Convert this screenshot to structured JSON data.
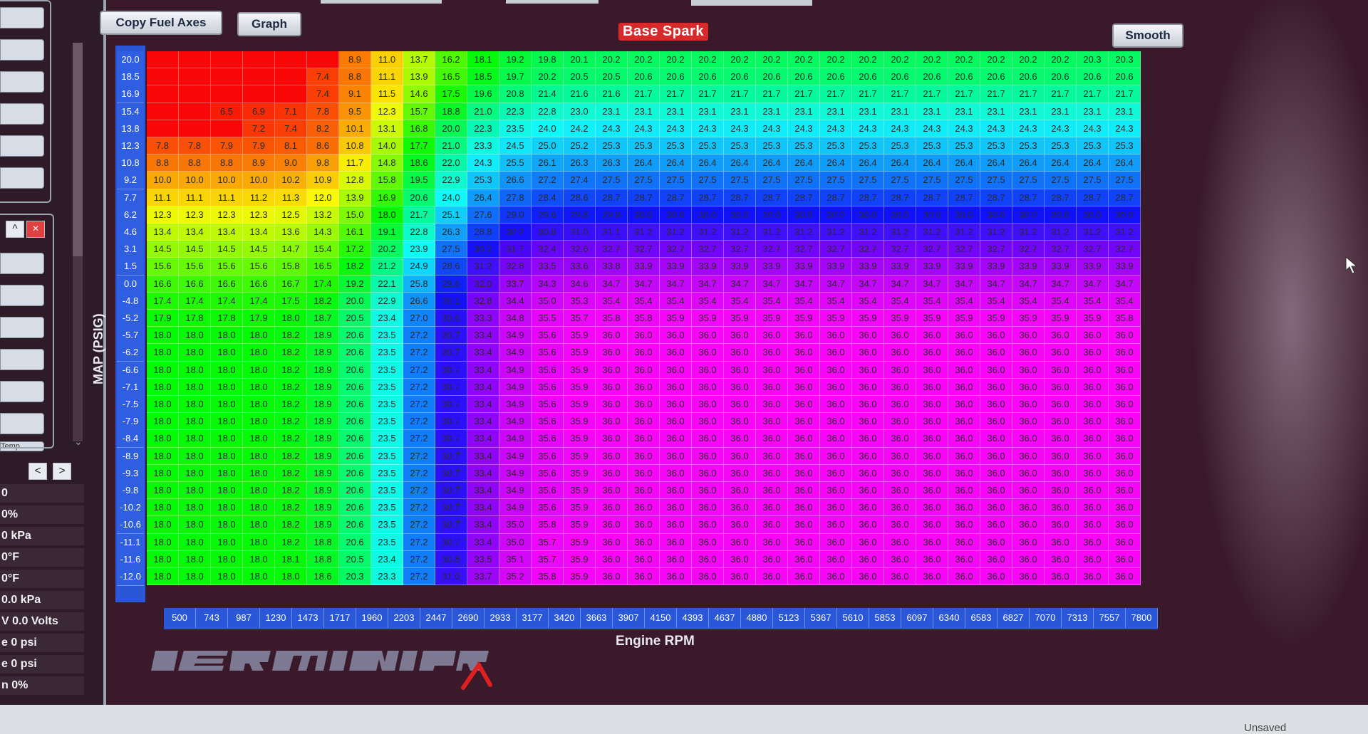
{
  "toolbar": {
    "copy_fuel_axes_label": "Copy Fuel Axes",
    "graph_label": "Graph",
    "smooth_label": "Smooth"
  },
  "table": {
    "title": "Base Spark",
    "x_axis_label": "Engine RPM",
    "y_axis_label": "MAP (PSIG)",
    "rpm": [
      500,
      743,
      987,
      1230,
      1473,
      1717,
      1960,
      2203,
      2447,
      2690,
      2933,
      3177,
      3420,
      3663,
      3907,
      4150,
      4393,
      4637,
      4880,
      5123,
      5367,
      5610,
      5853,
      6097,
      6340,
      6583,
      6827,
      7070,
      7313,
      7557,
      7800
    ],
    "map": [
      "20.0",
      "18.5",
      "16.9",
      "15.4",
      "13.8",
      "12.3",
      "10.8",
      "9.2",
      "7.7",
      "6.2",
      "4.6",
      "3.1",
      "1.5",
      "0.0",
      "-4.8",
      "-5.2",
      "-5.7",
      "-6.2",
      "-6.6",
      "-7.1",
      "-7.5",
      "-7.9",
      "-8.4",
      "-8.9",
      "-9.3",
      "-9.8",
      "-10.2",
      "-10.6",
      "-11.1",
      "-11.6",
      "-12.0"
    ],
    "rows": [
      [
        "",
        "",
        "",
        "",
        "",
        "",
        "8.9",
        "11.0",
        "13.7",
        "16.2",
        "18.1",
        "19.2",
        "19.8",
        "20.1",
        "20.2",
        "20.2",
        "20.2",
        "20.2",
        "20.2",
        "20.2",
        "20.2",
        "20.2",
        "20.2",
        "20.2",
        "20.2",
        "20.2",
        "20.2",
        "20.2",
        "20.2",
        "20.3",
        "20.3"
      ],
      [
        "",
        "",
        "",
        "",
        "",
        "7.4",
        "8.8",
        "11.1",
        "13.9",
        "16.5",
        "18.5",
        "19.7",
        "20.2",
        "20.5",
        "20.5",
        "20.6",
        "20.6",
        "20.6",
        "20.6",
        "20.6",
        "20.6",
        "20.6",
        "20.6",
        "20.6",
        "20.6",
        "20.6",
        "20.6",
        "20.6",
        "20.6",
        "20.6",
        "20.6"
      ],
      [
        "",
        "",
        "",
        "",
        "",
        "7.4",
        "9.1",
        "11.5",
        "14.6",
        "17.5",
        "19.6",
        "20.8",
        "21.4",
        "21.6",
        "21.6",
        "21.7",
        "21.7",
        "21.7",
        "21.7",
        "21.7",
        "21.7",
        "21.7",
        "21.7",
        "21.7",
        "21.7",
        "21.7",
        "21.7",
        "21.7",
        "21.7",
        "21.7",
        "21.7"
      ],
      [
        "",
        "",
        "6.5",
        "6.9",
        "7.1",
        "7.8",
        "9.5",
        "12.3",
        "15.7",
        "18.8",
        "21.0",
        "22.3",
        "22.8",
        "23.0",
        "23.1",
        "23.1",
        "23.1",
        "23.1",
        "23.1",
        "23.1",
        "23.1",
        "23.1",
        "23.1",
        "23.1",
        "23.1",
        "23.1",
        "23.1",
        "23.1",
        "23.1",
        "23.1",
        "23.1"
      ],
      [
        "",
        "",
        "",
        "7.2",
        "7.4",
        "8.2",
        "10.1",
        "13.1",
        "16.8",
        "20.0",
        "22.3",
        "23.5",
        "24.0",
        "24.2",
        "24.3",
        "24.3",
        "24.3",
        "24.3",
        "24.3",
        "24.3",
        "24.3",
        "24.3",
        "24.3",
        "24.3",
        "24.3",
        "24.3",
        "24.3",
        "24.3",
        "24.3",
        "24.3",
        "24.3"
      ],
      [
        "7.8",
        "7.8",
        "7.9",
        "7.9",
        "8.1",
        "8.6",
        "10.8",
        "14.0",
        "17.7",
        "21.0",
        "23.3",
        "24.5",
        "25.0",
        "25.2",
        "25.3",
        "25.3",
        "25.3",
        "25.3",
        "25.3",
        "25.3",
        "25.3",
        "25.3",
        "25.3",
        "25.3",
        "25.3",
        "25.3",
        "25.3",
        "25.3",
        "25.3",
        "25.3",
        "25.3"
      ],
      [
        "8.8",
        "8.8",
        "8.8",
        "8.9",
        "9.0",
        "9.8",
        "11.7",
        "14.8",
        "18.6",
        "22.0",
        "24.3",
        "25.5",
        "26.1",
        "26.3",
        "26.3",
        "26.4",
        "26.4",
        "26.4",
        "26.4",
        "26.4",
        "26.4",
        "26.4",
        "26.4",
        "26.4",
        "26.4",
        "26.4",
        "26.4",
        "26.4",
        "26.4",
        "26.4",
        "26.4"
      ],
      [
        "10.0",
        "10.0",
        "10.0",
        "10.0",
        "10.2",
        "10.9",
        "12.8",
        "15.8",
        "19.5",
        "22.9",
        "25.3",
        "26.6",
        "27.2",
        "27.4",
        "27.5",
        "27.5",
        "27.5",
        "27.5",
        "27.5",
        "27.5",
        "27.5",
        "27.5",
        "27.5",
        "27.5",
        "27.5",
        "27.5",
        "27.5",
        "27.5",
        "27.5",
        "27.5",
        "27.5"
      ],
      [
        "11.1",
        "11.1",
        "11.1",
        "11.2",
        "11.3",
        "12.0",
        "13.9",
        "16.9",
        "20.6",
        "24.0",
        "26.4",
        "27.8",
        "28.4",
        "28.6",
        "28.7",
        "28.7",
        "28.7",
        "28.7",
        "28.7",
        "28.7",
        "28.7",
        "28.7",
        "28.7",
        "28.7",
        "28.7",
        "28.7",
        "28.7",
        "28.7",
        "28.7",
        "28.7",
        "28.7"
      ],
      [
        "12.3",
        "12.3",
        "12.3",
        "12.3",
        "12.5",
        "13.2",
        "15.0",
        "18.0",
        "21.7",
        "25.1",
        "27.6",
        "29.0",
        "29.6",
        "29.8",
        "29.9",
        "30.0",
        "30.0",
        "30.0",
        "30.0",
        "30.0",
        "30.0",
        "30.0",
        "30.0",
        "30.0",
        "30.0",
        "30.0",
        "30.0",
        "30.0",
        "30.0",
        "30.0",
        "30.0"
      ],
      [
        "13.4",
        "13.4",
        "13.4",
        "13.4",
        "13.6",
        "14.3",
        "16.1",
        "19.1",
        "22.8",
        "26.3",
        "28.8",
        "30.2",
        "30.8",
        "31.0",
        "31.1",
        "31.2",
        "31.2",
        "31.2",
        "31.2",
        "31.2",
        "31.2",
        "31.2",
        "31.2",
        "31.2",
        "31.2",
        "31.2",
        "31.2",
        "31.2",
        "31.2",
        "31.2",
        "31.2"
      ],
      [
        "14.5",
        "14.5",
        "14.5",
        "14.5",
        "14.7",
        "15.4",
        "17.2",
        "20.2",
        "23.9",
        "27.5",
        "30.2",
        "31.7",
        "32.4",
        "32.6",
        "32.7",
        "32.7",
        "32.7",
        "32.7",
        "32.7",
        "32.7",
        "32.7",
        "32.7",
        "32.7",
        "32.7",
        "32.7",
        "32.7",
        "32.7",
        "32.7",
        "32.7",
        "32.7",
        "32.7"
      ],
      [
        "15.6",
        "15.6",
        "15.6",
        "15.6",
        "15.8",
        "16.5",
        "18.2",
        "21.2",
        "24.9",
        "28.6",
        "31.2",
        "32.8",
        "33.5",
        "33.6",
        "33.8",
        "33.9",
        "33.9",
        "33.9",
        "33.9",
        "33.9",
        "33.9",
        "33.9",
        "33.9",
        "33.9",
        "33.9",
        "33.9",
        "33.9",
        "33.9",
        "33.9",
        "33.9",
        "33.9"
      ],
      [
        "16.6",
        "16.6",
        "16.6",
        "16.6",
        "16.7",
        "17.4",
        "19.2",
        "22.1",
        "25.8",
        "29.6",
        "32.0",
        "33.7",
        "34.3",
        "34.6",
        "34.7",
        "34.7",
        "34.7",
        "34.7",
        "34.7",
        "34.7",
        "34.7",
        "34.7",
        "34.7",
        "34.7",
        "34.7",
        "34.7",
        "34.7",
        "34.7",
        "34.7",
        "34.7",
        "34.7"
      ],
      [
        "17.4",
        "17.4",
        "17.4",
        "17.4",
        "17.5",
        "18.2",
        "20.0",
        "22.9",
        "26.6",
        "30.1",
        "32.8",
        "34.4",
        "35.0",
        "35.3",
        "35.4",
        "35.4",
        "35.4",
        "35.4",
        "35.4",
        "35.4",
        "35.4",
        "35.4",
        "35.4",
        "35.4",
        "35.4",
        "35.4",
        "35.4",
        "35.4",
        "35.4",
        "35.4",
        "35.4"
      ],
      [
        "17.9",
        "17.8",
        "17.8",
        "17.9",
        "18.0",
        "18.7",
        "20.5",
        "23.4",
        "27.0",
        "30.6",
        "33.3",
        "34.8",
        "35.5",
        "35.7",
        "35.8",
        "35.8",
        "35.9",
        "35.9",
        "35.9",
        "35.9",
        "35.9",
        "35.9",
        "35.9",
        "35.9",
        "35.9",
        "35.9",
        "35.9",
        "35.9",
        "35.9",
        "35.9",
        "35.8"
      ],
      [
        "18.0",
        "18.0",
        "18.0",
        "18.0",
        "18.2",
        "18.9",
        "20.6",
        "23.5",
        "27.2",
        "30.7",
        "33.4",
        "34.9",
        "35.6",
        "35.9",
        "36.0",
        "36.0",
        "36.0",
        "36.0",
        "36.0",
        "36.0",
        "36.0",
        "36.0",
        "36.0",
        "36.0",
        "36.0",
        "36.0",
        "36.0",
        "36.0",
        "36.0",
        "36.0",
        "36.0"
      ],
      [
        "18.0",
        "18.0",
        "18.0",
        "18.0",
        "18.2",
        "18.9",
        "20.6",
        "23.5",
        "27.2",
        "30.7",
        "33.4",
        "34.9",
        "35.6",
        "35.9",
        "36.0",
        "36.0",
        "36.0",
        "36.0",
        "36.0",
        "36.0",
        "36.0",
        "36.0",
        "36.0",
        "36.0",
        "36.0",
        "36.0",
        "36.0",
        "36.0",
        "36.0",
        "36.0",
        "36.0"
      ],
      [
        "18.0",
        "18.0",
        "18.0",
        "18.0",
        "18.2",
        "18.9",
        "20.6",
        "23.5",
        "27.2",
        "30.7",
        "33.4",
        "34.9",
        "35.6",
        "35.9",
        "36.0",
        "36.0",
        "36.0",
        "36.0",
        "36.0",
        "36.0",
        "36.0",
        "36.0",
        "36.0",
        "36.0",
        "36.0",
        "36.0",
        "36.0",
        "36.0",
        "36.0",
        "36.0",
        "36.0"
      ],
      [
        "18.0",
        "18.0",
        "18.0",
        "18.0",
        "18.2",
        "18.9",
        "20.6",
        "23.5",
        "27.2",
        "30.7",
        "33.4",
        "34.9",
        "35.6",
        "35.9",
        "36.0",
        "36.0",
        "36.0",
        "36.0",
        "36.0",
        "36.0",
        "36.0",
        "36.0",
        "36.0",
        "36.0",
        "36.0",
        "36.0",
        "36.0",
        "36.0",
        "36.0",
        "36.0",
        "36.0"
      ],
      [
        "18.0",
        "18.0",
        "18.0",
        "18.0",
        "18.2",
        "18.9",
        "20.6",
        "23.5",
        "27.2",
        "30.7",
        "33.4",
        "34.9",
        "35.6",
        "35.9",
        "36.0",
        "36.0",
        "36.0",
        "36.0",
        "36.0",
        "36.0",
        "36.0",
        "36.0",
        "36.0",
        "36.0",
        "36.0",
        "36.0",
        "36.0",
        "36.0",
        "36.0",
        "36.0",
        "36.0"
      ],
      [
        "18.0",
        "18.0",
        "18.0",
        "18.0",
        "18.2",
        "18.9",
        "20.6",
        "23.5",
        "27.2",
        "30.7",
        "33.4",
        "34.9",
        "35.6",
        "35.9",
        "36.0",
        "36.0",
        "36.0",
        "36.0",
        "36.0",
        "36.0",
        "36.0",
        "36.0",
        "36.0",
        "36.0",
        "36.0",
        "36.0",
        "36.0",
        "36.0",
        "36.0",
        "36.0",
        "36.0"
      ],
      [
        "18.0",
        "18.0",
        "18.0",
        "18.0",
        "18.2",
        "18.9",
        "20.6",
        "23.5",
        "27.2",
        "30.7",
        "33.4",
        "34.9",
        "35.6",
        "35.9",
        "36.0",
        "36.0",
        "36.0",
        "36.0",
        "36.0",
        "36.0",
        "36.0",
        "36.0",
        "36.0",
        "36.0",
        "36.0",
        "36.0",
        "36.0",
        "36.0",
        "36.0",
        "36.0",
        "36.0"
      ],
      [
        "18.0",
        "18.0",
        "18.0",
        "18.0",
        "18.2",
        "18.9",
        "20.6",
        "23.5",
        "27.2",
        "30.7",
        "33.4",
        "34.9",
        "35.6",
        "35.9",
        "36.0",
        "36.0",
        "36.0",
        "36.0",
        "36.0",
        "36.0",
        "36.0",
        "36.0",
        "36.0",
        "36.0",
        "36.0",
        "36.0",
        "36.0",
        "36.0",
        "36.0",
        "36.0",
        "36.0"
      ],
      [
        "18.0",
        "18.0",
        "18.0",
        "18.0",
        "18.2",
        "18.9",
        "20.6",
        "23.5",
        "27.2",
        "30.7",
        "33.4",
        "34.9",
        "35.6",
        "35.9",
        "36.0",
        "36.0",
        "36.0",
        "36.0",
        "36.0",
        "36.0",
        "36.0",
        "36.0",
        "36.0",
        "36.0",
        "36.0",
        "36.0",
        "36.0",
        "36.0",
        "36.0",
        "36.0",
        "36.0"
      ],
      [
        "18.0",
        "18.0",
        "18.0",
        "18.0",
        "18.2",
        "18.9",
        "20.6",
        "23.5",
        "27.2",
        "30.7",
        "33.4",
        "34.9",
        "35.6",
        "35.9",
        "36.0",
        "36.0",
        "36.0",
        "36.0",
        "36.0",
        "36.0",
        "36.0",
        "36.0",
        "36.0",
        "36.0",
        "36.0",
        "36.0",
        "36.0",
        "36.0",
        "36.0",
        "36.0",
        "36.0"
      ],
      [
        "18.0",
        "18.0",
        "18.0",
        "18.0",
        "18.2",
        "18.9",
        "20.6",
        "23.5",
        "27.2",
        "30.7",
        "33.4",
        "34.9",
        "35.6",
        "35.9",
        "36.0",
        "36.0",
        "36.0",
        "36.0",
        "36.0",
        "36.0",
        "36.0",
        "36.0",
        "36.0",
        "36.0",
        "36.0",
        "36.0",
        "36.0",
        "36.0",
        "36.0",
        "36.0",
        "36.0"
      ],
      [
        "18.0",
        "18.0",
        "18.0",
        "18.0",
        "18.2",
        "18.9",
        "20.6",
        "23.5",
        "27.2",
        "30.7",
        "33.4",
        "35.0",
        "35.8",
        "35.9",
        "36.0",
        "36.0",
        "36.0",
        "36.0",
        "36.0",
        "36.0",
        "36.0",
        "36.0",
        "36.0",
        "36.0",
        "36.0",
        "36.0",
        "36.0",
        "36.0",
        "36.0",
        "36.0",
        "36.0"
      ],
      [
        "18.0",
        "18.0",
        "18.0",
        "18.0",
        "18.2",
        "18.8",
        "20.6",
        "23.5",
        "27.2",
        "30.7",
        "33.4",
        "35.0",
        "35.7",
        "35.9",
        "36.0",
        "36.0",
        "36.0",
        "36.0",
        "36.0",
        "36.0",
        "36.0",
        "36.0",
        "36.0",
        "36.0",
        "36.0",
        "36.0",
        "36.0",
        "36.0",
        "36.0",
        "36.0",
        "36.0"
      ],
      [
        "18.0",
        "18.0",
        "18.0",
        "18.0",
        "18.1",
        "18.8",
        "20.5",
        "23.4",
        "27.2",
        "30.8",
        "33.5",
        "35.1",
        "35.7",
        "35.9",
        "36.0",
        "36.0",
        "36.0",
        "36.0",
        "36.0",
        "36.0",
        "36.0",
        "36.0",
        "36.0",
        "36.0",
        "36.0",
        "36.0",
        "36.0",
        "36.0",
        "36.0",
        "36.0",
        "36.0"
      ],
      [
        "18.0",
        "18.0",
        "18.0",
        "18.0",
        "18.0",
        "18.6",
        "20.3",
        "23.3",
        "27.2",
        "31.0",
        "33.7",
        "35.2",
        "35.8",
        "35.9",
        "36.0",
        "36.0",
        "36.0",
        "36.0",
        "36.0",
        "36.0",
        "36.0",
        "36.0",
        "36.0",
        "36.0",
        "36.0",
        "36.0",
        "36.0",
        "36.0",
        "36.0",
        "36.0",
        "36.0"
      ]
    ]
  },
  "sensors": [
    "0",
    "0%",
    "0 kPa",
    "0°F",
    "0°F",
    "0.0 kPa",
    "V 0.0 Volts",
    "e 0 psi",
    "e 0 psi",
    "n 0%"
  ],
  "left_panel": {
    "temp_label": "Temp",
    "nav_prev": "<",
    "nav_next": ">"
  },
  "status": {
    "unsaved": "Unsaved"
  },
  "colors": {
    "axis_blue": "#2f5ee0",
    "title_red": "#d82a2a",
    "background": "#3a1a2a"
  }
}
